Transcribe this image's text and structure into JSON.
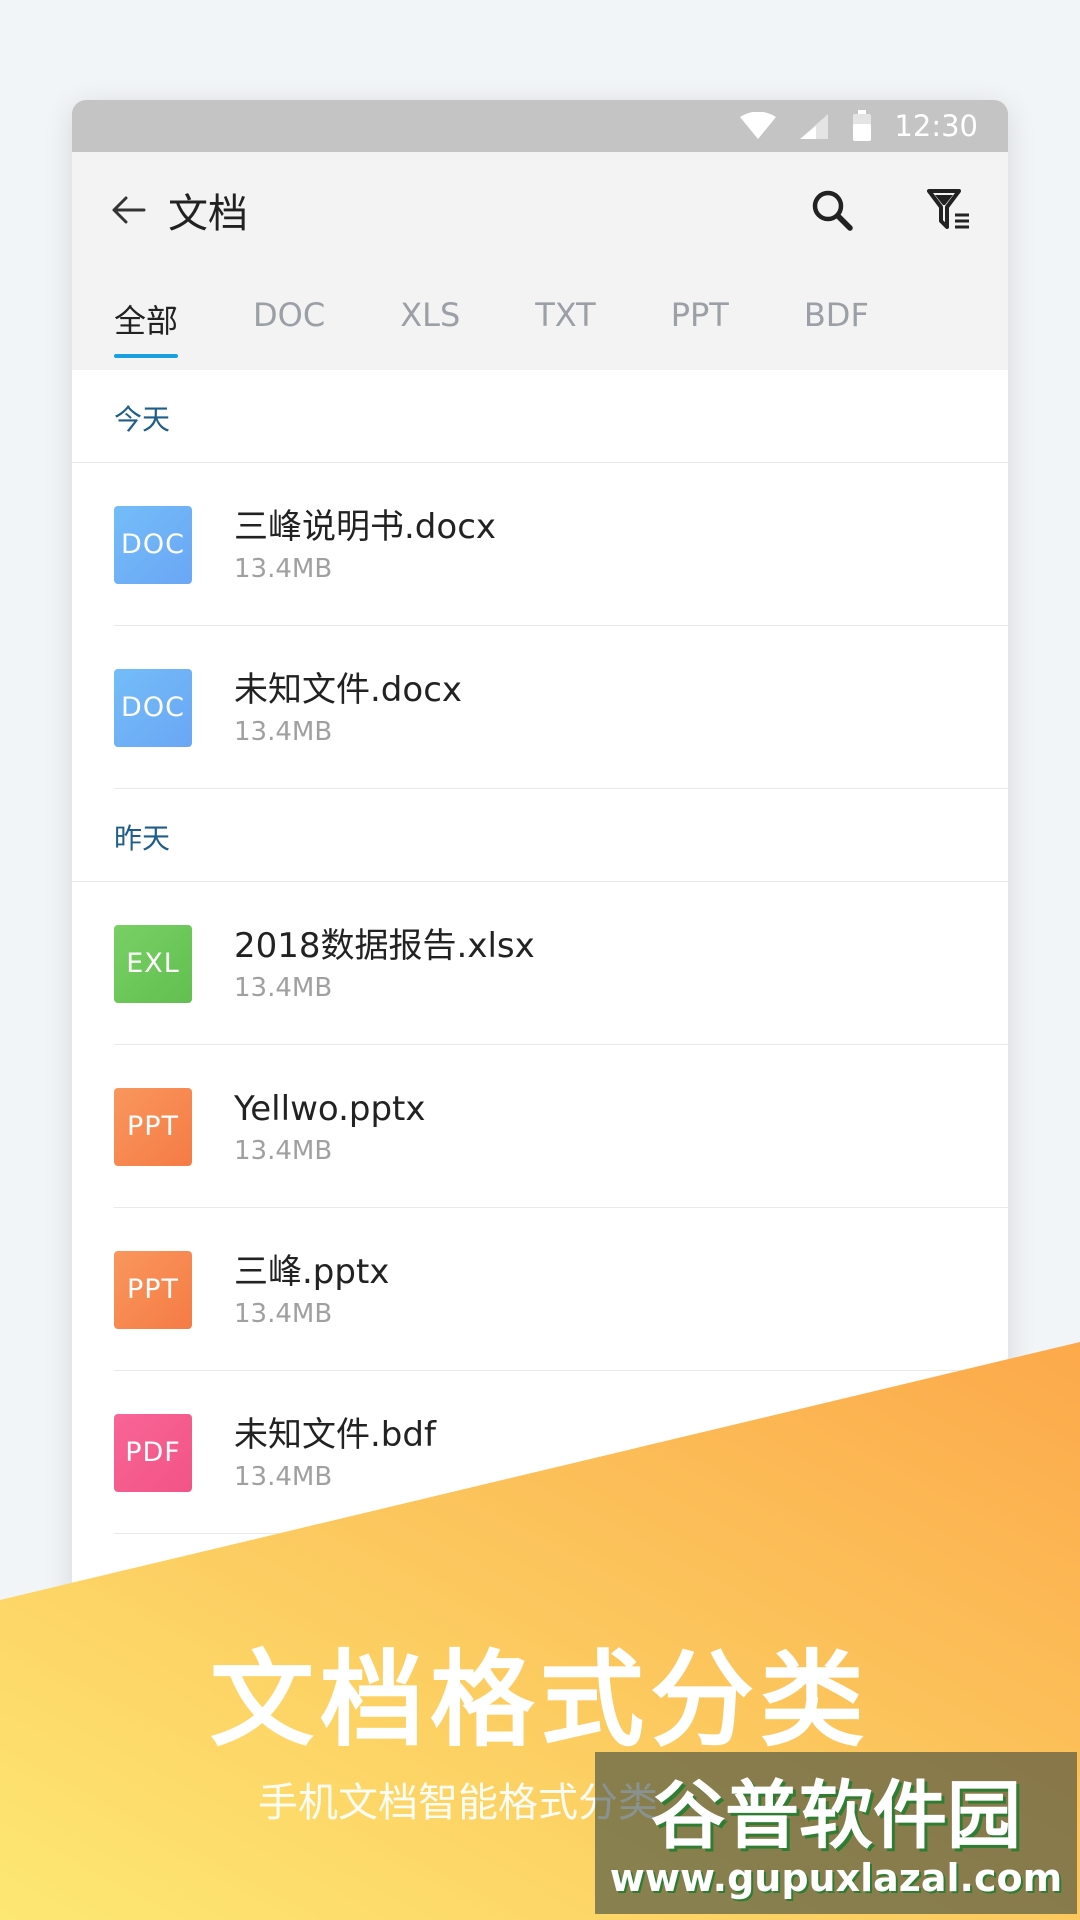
{
  "status_bar": {
    "time": "12:30"
  },
  "header": {
    "title": "文档"
  },
  "tabs": [
    {
      "label": "全部",
      "active": true
    },
    {
      "label": "DOC",
      "active": false
    },
    {
      "label": "XLS",
      "active": false
    },
    {
      "label": "TXT",
      "active": false
    },
    {
      "label": "PPT",
      "active": false
    },
    {
      "label": "BDF",
      "active": false
    }
  ],
  "sections": [
    {
      "label": "今天",
      "files": [
        {
          "badge": "DOC",
          "name": "三峰说明书.docx",
          "size": "13.4MB"
        },
        {
          "badge": "DOC",
          "name": "未知文件.docx",
          "size": "13.4MB"
        }
      ]
    },
    {
      "label": "昨天",
      "files": [
        {
          "badge": "EXL",
          "name": "2018数据报告.xlsx",
          "size": "13.4MB"
        },
        {
          "badge": "PPT",
          "name": "Yellwo.pptx",
          "size": "13.4MB"
        },
        {
          "badge": "PPT",
          "name": "三峰.pptx",
          "size": "13.4MB"
        },
        {
          "badge": "PDF",
          "name": "未知文件.bdf",
          "size": "13.4MB"
        }
      ]
    }
  ],
  "colors": {
    "doc": "#6fb2f7",
    "exl": "#6cc75a",
    "ppt": "#f7864f",
    "pdf": "#f55d8d",
    "accent": "#1a9fe0",
    "banner_start": "#fde873",
    "banner_end": "#fca94a"
  },
  "banner": {
    "headline": "文档格式分类",
    "subline": "手机文档智能格式分类"
  },
  "watermark": {
    "top": "谷普软件园",
    "bottom": "www.gupuxlazal.com"
  }
}
